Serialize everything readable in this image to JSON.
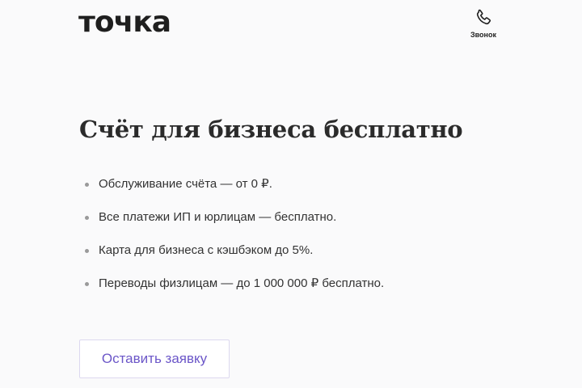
{
  "header": {
    "logo_text": "точка",
    "call": {
      "icon": "phone-icon",
      "label": "Звонок"
    }
  },
  "main": {
    "title": "Счёт для бизнеса бесплатно",
    "features": [
      "Обслуживание счёта — от 0 ₽.",
      "Все платежи ИП и юрлицам — бесплатно.",
      "Карта для бизнеса с кэшбэком до 5%.",
      "Переводы физлицам — до 1 000 000 ₽ бесплатно."
    ],
    "cta_label": "Оставить заявку"
  },
  "colors": {
    "background": "#fafafb",
    "text": "#2b2b2b",
    "accent": "#6b56c8",
    "button_border": "#dcd8ef"
  }
}
